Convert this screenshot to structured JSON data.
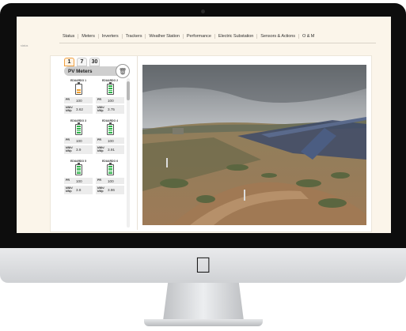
{
  "nav": {
    "items": [
      "Status",
      "Meters",
      "Inverters",
      "Trackers",
      "Weather Station",
      "Performance",
      "Electric Substation",
      "Sensors & Actions",
      "O & M"
    ]
  },
  "breadcrumb": "status",
  "period_tabs": [
    "1",
    "7",
    "30"
  ],
  "pv_meters": {
    "title": "PV Meters",
    "trash_icon": "trash-icon",
    "pr_label": "PR",
    "kwh_label": "kWh/ kWp",
    "meters": [
      {
        "name": "EDUARDO 1",
        "pr": "100",
        "kwh": "3.62",
        "level": 0.45,
        "color": "orange"
      },
      {
        "name": "EDUARDO 2",
        "pr": "100",
        "kwh": "3.75",
        "level": 0.9,
        "color": "green"
      },
      {
        "name": "EDUARDO 3",
        "pr": "100",
        "kwh": "3.9",
        "level": 0.9,
        "color": "green"
      },
      {
        "name": "EDUARDO 4",
        "pr": "100",
        "kwh": "3.91",
        "level": 0.9,
        "color": "green"
      },
      {
        "name": "EDUARDO 5",
        "pr": "100",
        "kwh": "3.8",
        "level": 0.9,
        "color": "green"
      },
      {
        "name": "EDUARDO 6",
        "pr": "100",
        "kwh": "3.86",
        "level": 0.9,
        "color": "green"
      }
    ]
  },
  "device": {
    "logo": "apple-logo"
  }
}
